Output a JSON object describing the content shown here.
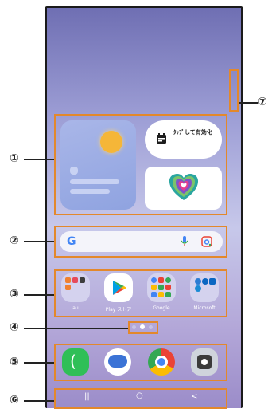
{
  "callouts": [
    "①",
    "②",
    "③",
    "④",
    "⑤",
    "⑥",
    "⑦"
  ],
  "widget": {
    "calendar_text": "ﾀｯﾌﾟして有効化"
  },
  "apps": [
    "au",
    "Play ストア",
    "Google",
    "Microsoft"
  ],
  "nav": {
    "recent": "|||",
    "home": "○",
    "back": "<"
  },
  "colors": {
    "callout_box": "#e3882b"
  }
}
